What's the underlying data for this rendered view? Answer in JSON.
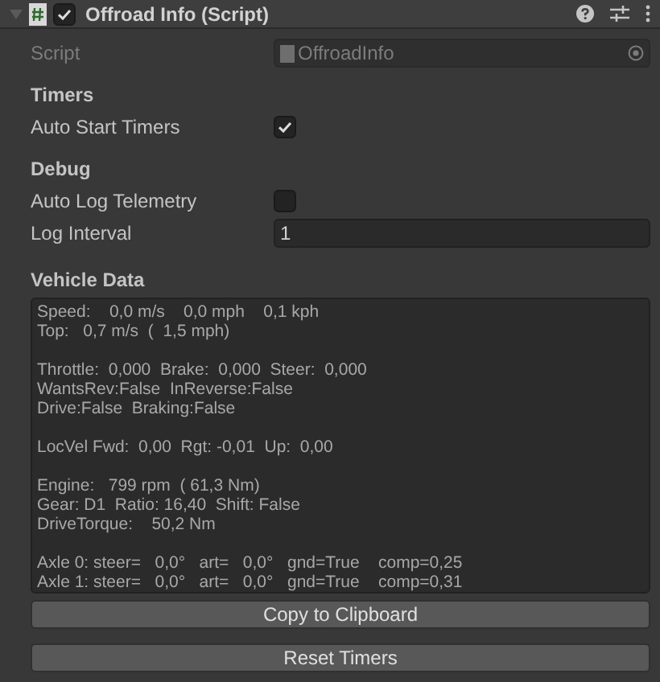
{
  "component": {
    "title": "Offroad Info (Script)",
    "enabled": true,
    "expanded": true
  },
  "script_field": {
    "label": "Script",
    "value": "OffroadInfo"
  },
  "sections": [
    {
      "header": "Timers",
      "fields": [
        {
          "kind": "checkbox",
          "label": "Auto Start Timers",
          "checked": true
        }
      ]
    },
    {
      "header": "Debug",
      "fields": [
        {
          "kind": "checkbox",
          "label": "Auto Log Telemetry",
          "checked": false
        },
        {
          "kind": "number",
          "label": "Log Interval",
          "value": "1"
        }
      ]
    }
  ],
  "vehicle_data": {
    "header": "Vehicle Data",
    "blocks": [
      [
        "Speed:    0,0 m/s    0,0 mph    0,1 kph",
        "Top:   0,7 m/s  (  1,5 mph)"
      ],
      [
        "Throttle:  0,000  Brake:  0,000  Steer:  0,000",
        "WantsRev:False  InReverse:False",
        "Drive:False  Braking:False"
      ],
      [
        "LocVel Fwd:  0,00  Rgt: -0,01  Up:  0,00"
      ],
      [
        "Engine:   799 rpm  ( 61,3 Nm)",
        "Gear: D1  Ratio: 16,40  Shift: False",
        "DriveTorque:    50,2 Nm"
      ],
      [
        "Axle 0: steer=   0,0°   art=   0,0°   gnd=True    comp=0,25",
        "Axle 1: steer=   0,0°   art=   0,0°   gnd=True    comp=0,31"
      ]
    ]
  },
  "buttons": [
    "Copy to Clipboard",
    "Reset Timers"
  ]
}
